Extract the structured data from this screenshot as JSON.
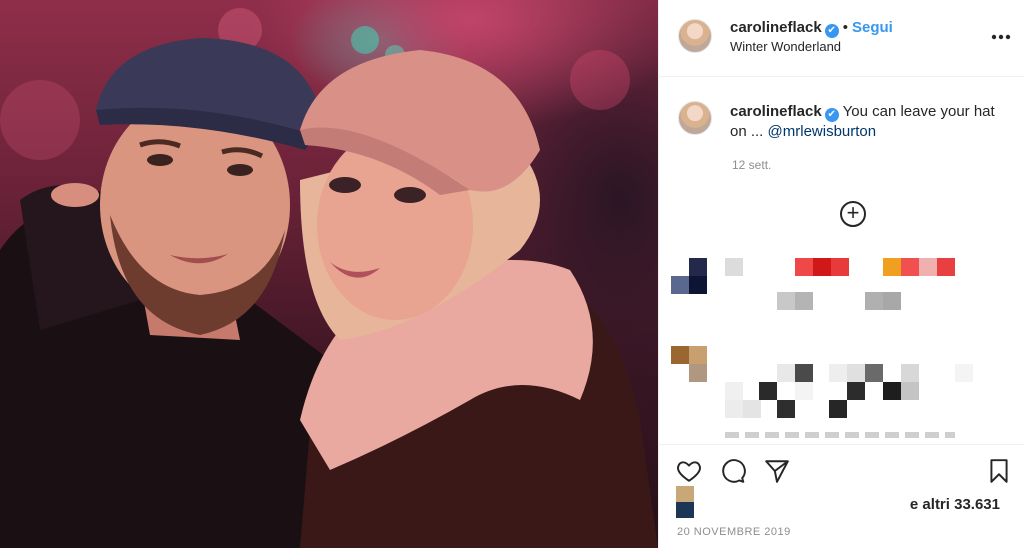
{
  "post": {
    "username": "carolineflack",
    "verified_mark": "✔",
    "separator": "•",
    "follow_label": "Segui",
    "location": "Winter Wonderland",
    "more_label": "•••"
  },
  "caption": {
    "username": "carolineflack",
    "text": "You can leave your hat on ...",
    "mention": "@mrlewisburton",
    "time_ago": "12 sett."
  },
  "comments": {
    "load_more_label": "+"
  },
  "footer": {
    "likes_text": "e altri 33.631",
    "date": "20 NOVEMBRE 2019"
  },
  "icons": {
    "like": "heart-icon",
    "comment": "comment-icon",
    "share": "paper-plane-icon",
    "save": "bookmark-icon",
    "more": "more-horizontal-icon",
    "load_more": "plus-circle-icon"
  },
  "colors": {
    "link": "#3897f0",
    "mention": "#00376b",
    "secondary_text": "#8e8e8e",
    "primary_text": "#262626",
    "border": "#efefef"
  }
}
